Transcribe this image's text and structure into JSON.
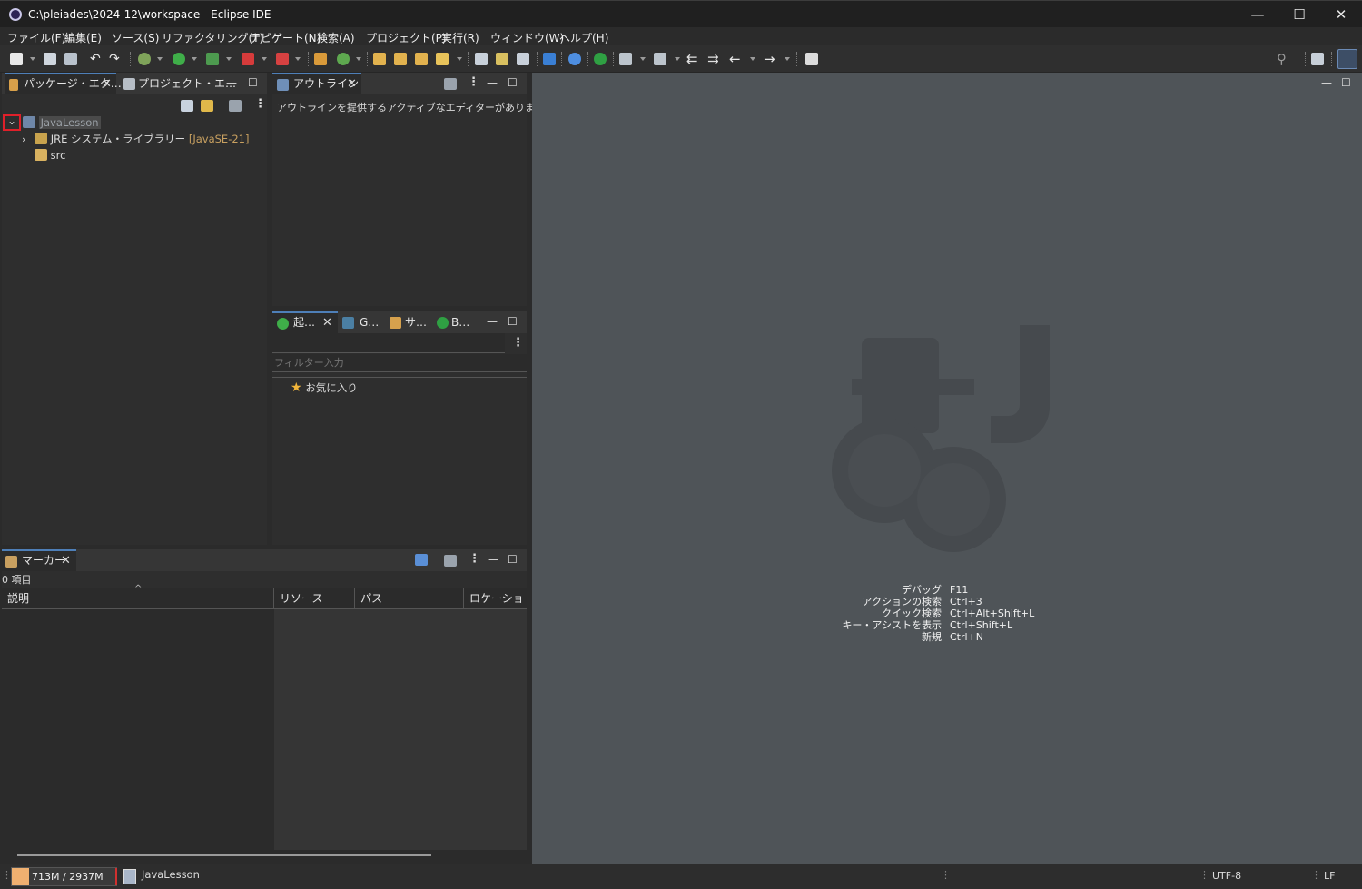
{
  "window": {
    "title": "C:\\pleiades\\2024-12\\workspace - Eclipse IDE",
    "minimize_glyph": "—",
    "maximize_glyph": "☐",
    "close_glyph": "✕"
  },
  "menu": [
    "ファイル(F)",
    "編集(E)",
    "ソース(S)",
    "リファクタリング(T)",
    "ナビゲート(N)",
    "検索(A)",
    "プロジェクト(P)",
    "実行(R)",
    "ウィンドウ(W)",
    "ヘルプ(H)"
  ],
  "package_explorer": {
    "tabs": [
      "パッケージ・エク…",
      "プロジェクト・エ…"
    ],
    "tree": {
      "project": "JavaLesson",
      "jre_label": "JRE システム・ライブラリー",
      "jre_version": "[JavaSE-21]",
      "src": "src"
    }
  },
  "outline": {
    "tab": "アウトライン",
    "message": "アウトラインを提供するアクティブなエディターがありません。"
  },
  "launch": {
    "tabs": [
      "起…",
      "G…",
      "サ…",
      "B…"
    ],
    "filter_placeholder": "フィルター入力",
    "favorites": "お気に入り"
  },
  "markers": {
    "tab": "マーカー",
    "count": "0 項目",
    "columns": [
      "説明",
      "リソース",
      "パス",
      "ロケーション"
    ]
  },
  "shortcuts": [
    {
      "label": "デバッグ",
      "key": "F11"
    },
    {
      "label": "アクションの検索",
      "key": "Ctrl+3"
    },
    {
      "label": "クイック検索",
      "key": "Ctrl+Alt+Shift+L"
    },
    {
      "label": "キー・アシストを表示",
      "key": "Ctrl+Shift+L"
    },
    {
      "label": "新規",
      "key": "Ctrl+N"
    }
  ],
  "status": {
    "heap": "713M / 2937M",
    "selected": "JavaLesson",
    "encoding": "UTF-8",
    "line_ending": "LF"
  },
  "colors": {
    "accent": "#4e7fb8",
    "editor_bg": "#4f5458",
    "highlight_red": "#e0202a",
    "jre_version": "#c8a060"
  }
}
